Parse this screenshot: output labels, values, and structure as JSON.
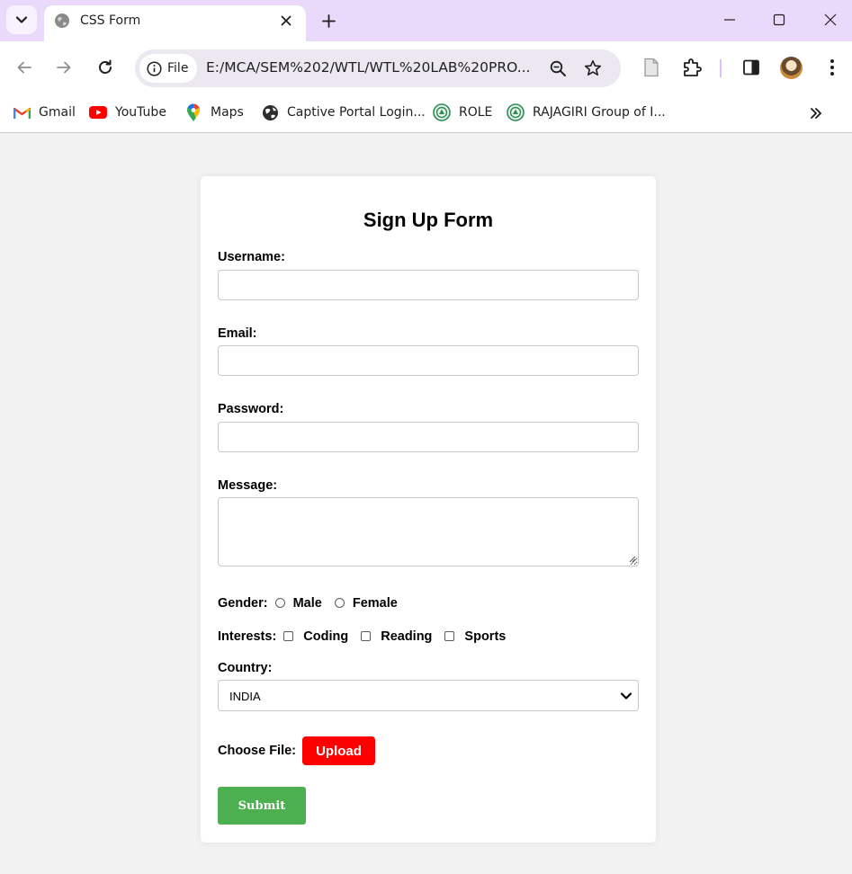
{
  "tab": {
    "title": "CSS Form"
  },
  "address_bar": {
    "chip_label": "File",
    "url": "E:/MCA/SEM%202/WTL/WTL%20LAB%20PRO..."
  },
  "bookmarks": [
    {
      "label": "Gmail",
      "icon": "gmail-icon"
    },
    {
      "label": "YouTube",
      "icon": "youtube-icon"
    },
    {
      "label": "Maps",
      "icon": "maps-icon"
    },
    {
      "label": "Captive Portal Login...",
      "icon": "globe-icon"
    },
    {
      "label": "ROLE",
      "icon": "rajagiri-icon"
    },
    {
      "label": "RAJAGIRI Group of I...",
      "icon": "rajagiri-icon"
    }
  ],
  "form": {
    "title": "Sign Up Form",
    "username_label": "Username:",
    "username_value": "",
    "email_label": "Email:",
    "email_value": "",
    "password_label": "Password:",
    "password_value": "",
    "message_label": "Message:",
    "message_value": "",
    "gender_label": "Gender:",
    "gender_options": [
      "Male",
      "Female"
    ],
    "interests_label": "Interests:",
    "interests_options": [
      "Coding",
      "Reading",
      "Sports"
    ],
    "country_label": "Country:",
    "country_value": "INDIA",
    "file_label": "Choose File:",
    "upload_label": "Upload",
    "submit_label": "Submit"
  },
  "colors": {
    "tabstrip": "#e9d9fb",
    "page_background": "#f2f2f2",
    "upload_button": "#ff0000",
    "submit_button": "#4caf50"
  }
}
